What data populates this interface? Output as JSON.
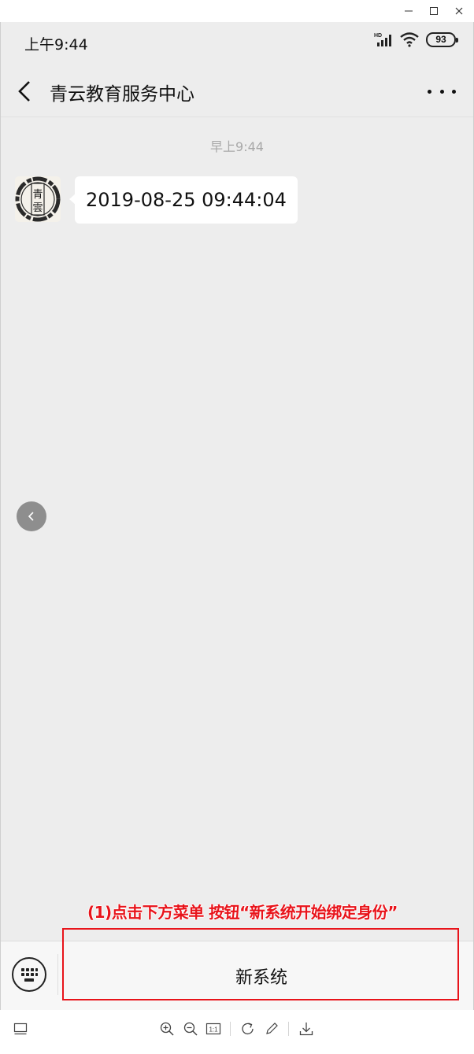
{
  "window": {
    "minimize_icon": "minimize-icon",
    "maximize_icon": "maximize-icon",
    "close_icon": "close-icon"
  },
  "status_bar": {
    "time": "上午9:44",
    "battery": "93",
    "network_label": "HD"
  },
  "nav": {
    "title": "青云教育服务中心",
    "back_icon": "back-arrow-icon",
    "more_icon": "more-icon"
  },
  "chat": {
    "timestamp": "早上9:44",
    "messages": [
      {
        "sender_avatar_text": "青雲",
        "text": "2019-08-25 09:44:04"
      }
    ]
  },
  "annotation": {
    "text": "(1)点击下方菜单 按钮“新系统开始绑定身份”",
    "color": "#e8141b"
  },
  "bottom_bar": {
    "keyboard_icon": "keyboard-icon",
    "menu_label": "新系统"
  },
  "viewer_toolbar": {
    "tools": [
      "monitor-icon",
      "zoom-in-icon",
      "zoom-out-icon",
      "actual-size-icon",
      "rotate-icon",
      "edit-icon",
      "download-icon"
    ],
    "actual_size_label": "1:1"
  },
  "colors": {
    "chat_background": "#ededed",
    "bubble": "#ffffff",
    "highlight": "#e8141b"
  }
}
